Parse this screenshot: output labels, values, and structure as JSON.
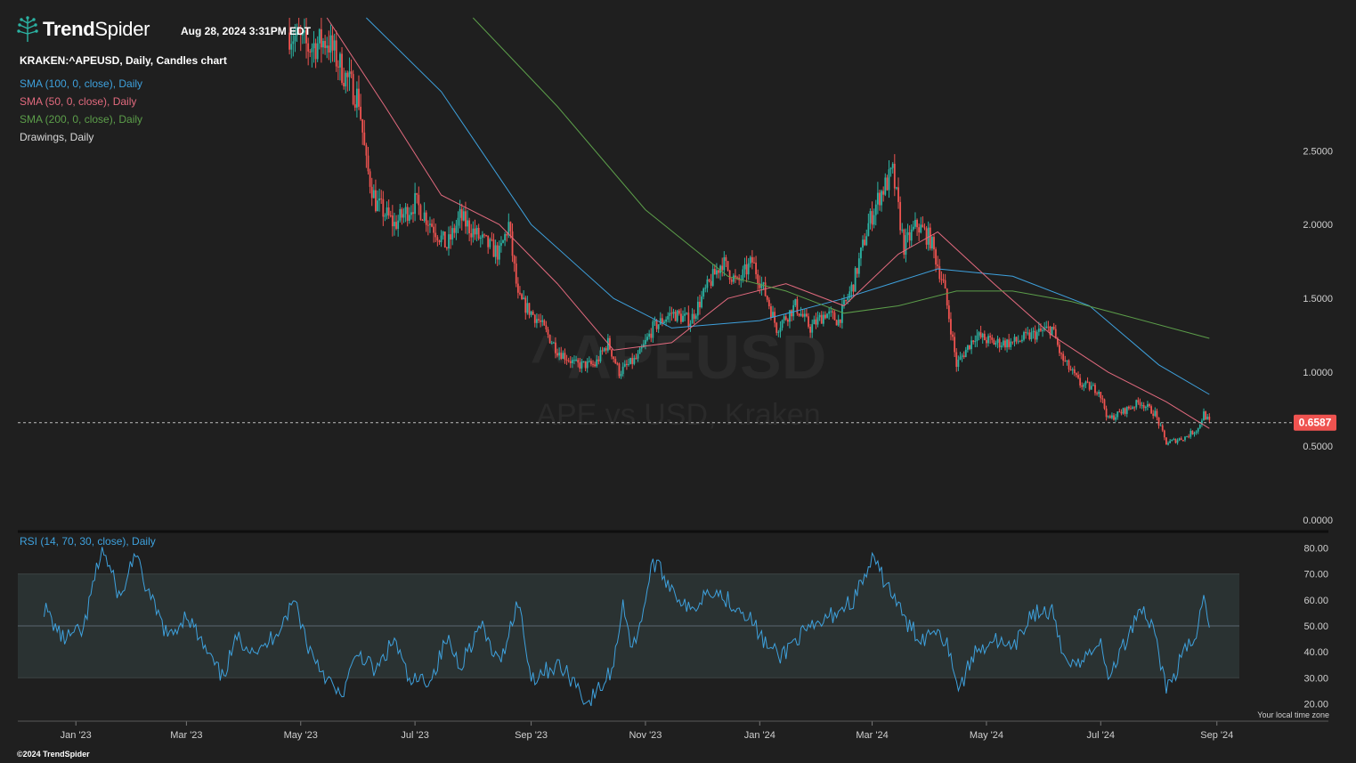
{
  "brand": {
    "name_bold": "Trend",
    "name_light": "Spider",
    "logo_icon": "tree-icon"
  },
  "timestamp": "Aug 28, 2024 3:31PM EDT",
  "chart_title": "KRAKEN:^APEUSD, Daily, Candles chart",
  "watermark": {
    "symbol": "^APEUSD",
    "description": "APE vs USD, Kraken"
  },
  "indicators": [
    {
      "label": "SMA (100, 0, close), Daily",
      "color": "#3ea1dd"
    },
    {
      "label": "SMA (50, 0, close), Daily",
      "color": "#e26a7e"
    },
    {
      "label": "SMA (200, 0, close), Daily",
      "color": "#5c9e4a"
    },
    {
      "label": "Drawings, Daily",
      "color": "#d8d8d8"
    }
  ],
  "rsi_label": "RSI (14, 70, 30, close), Daily",
  "footer": "©2024 TrendSpider",
  "timezone_note": "Your local time zone",
  "colors": {
    "background": "#1f1f1f",
    "candle_up": "#2bb3a3",
    "candle_down": "#ef5350",
    "price_tag": "#ef5350",
    "rsi_line": "#3ea1dd",
    "rsi_band": "#2a3232"
  },
  "chart_data": [
    {
      "type": "candlestick",
      "title": "KRAKEN:^APEUSD, Daily, Candles chart",
      "ylim": [
        0,
        3.4
      ],
      "y_ticks": [
        "0.0000",
        "0.5000",
        "1.0000",
        "1.5000",
        "2.0000",
        "2.5000"
      ],
      "x_ticks": [
        "Jan '23",
        "Mar '23",
        "May '23",
        "Jul '23",
        "Sep '23",
        "Nov '23",
        "Jan '24",
        "Mar '24",
        "May '24",
        "Jul '24",
        "Sep '24"
      ],
      "last_price": 0.6587,
      "last_price_label": "0.6587",
      "grid": false,
      "close_path": [
        {
          "date": "2023-04-25",
          "value": 3.3
        },
        {
          "date": "2023-05-05",
          "value": 3.2
        },
        {
          "date": "2023-05-15",
          "value": 3.25
        },
        {
          "date": "2023-05-25",
          "value": 3.0
        },
        {
          "date": "2023-06-01",
          "value": 2.85
        },
        {
          "date": "2023-06-05",
          "value": 2.4
        },
        {
          "date": "2023-06-10",
          "value": 2.15
        },
        {
          "date": "2023-06-20",
          "value": 2.0
        },
        {
          "date": "2023-07-01",
          "value": 2.15
        },
        {
          "date": "2023-07-10",
          "value": 2.0
        },
        {
          "date": "2023-07-18",
          "value": 1.85
        },
        {
          "date": "2023-07-25",
          "value": 2.05
        },
        {
          "date": "2023-08-05",
          "value": 1.9
        },
        {
          "date": "2023-08-15",
          "value": 1.8
        },
        {
          "date": "2023-08-20",
          "value": 2.0
        },
        {
          "date": "2023-08-25",
          "value": 1.5
        },
        {
          "date": "2023-09-05",
          "value": 1.35
        },
        {
          "date": "2023-09-15",
          "value": 1.15
        },
        {
          "date": "2023-09-25",
          "value": 1.05
        },
        {
          "date": "2023-10-05",
          "value": 1.05
        },
        {
          "date": "2023-10-12",
          "value": 1.2
        },
        {
          "date": "2023-10-18",
          "value": 1.0
        },
        {
          "date": "2023-10-28",
          "value": 1.1
        },
        {
          "date": "2023-11-05",
          "value": 1.3
        },
        {
          "date": "2023-11-15",
          "value": 1.4
        },
        {
          "date": "2023-11-25",
          "value": 1.35
        },
        {
          "date": "2023-12-05",
          "value": 1.6
        },
        {
          "date": "2023-12-12",
          "value": 1.75
        },
        {
          "date": "2023-12-20",
          "value": 1.6
        },
        {
          "date": "2023-12-28",
          "value": 1.75
        },
        {
          "date": "2024-01-05",
          "value": 1.5
        },
        {
          "date": "2024-01-10",
          "value": 1.3
        },
        {
          "date": "2024-01-20",
          "value": 1.45
        },
        {
          "date": "2024-01-28",
          "value": 1.3
        },
        {
          "date": "2024-02-05",
          "value": 1.4
        },
        {
          "date": "2024-02-12",
          "value": 1.35
        },
        {
          "date": "2024-02-20",
          "value": 1.6
        },
        {
          "date": "2024-02-28",
          "value": 2.0
        },
        {
          "date": "2024-03-05",
          "value": 2.2
        },
        {
          "date": "2024-03-12",
          "value": 2.35
        },
        {
          "date": "2024-03-18",
          "value": 1.85
        },
        {
          "date": "2024-03-25",
          "value": 2.0
        },
        {
          "date": "2024-04-01",
          "value": 1.9
        },
        {
          "date": "2024-04-08",
          "value": 1.6
        },
        {
          "date": "2024-04-12",
          "value": 1.3
        },
        {
          "date": "2024-04-15",
          "value": 1.05
        },
        {
          "date": "2024-04-25",
          "value": 1.25
        },
        {
          "date": "2024-05-05",
          "value": 1.2
        },
        {
          "date": "2024-05-15",
          "value": 1.2
        },
        {
          "date": "2024-05-25",
          "value": 1.25
        },
        {
          "date": "2024-06-05",
          "value": 1.3
        },
        {
          "date": "2024-06-10",
          "value": 1.1
        },
        {
          "date": "2024-06-20",
          "value": 0.92
        },
        {
          "date": "2024-06-30",
          "value": 0.88
        },
        {
          "date": "2024-07-05",
          "value": 0.68
        },
        {
          "date": "2024-07-15",
          "value": 0.75
        },
        {
          "date": "2024-07-22",
          "value": 0.8
        },
        {
          "date": "2024-07-30",
          "value": 0.72
        },
        {
          "date": "2024-08-05",
          "value": 0.52
        },
        {
          "date": "2024-08-15",
          "value": 0.56
        },
        {
          "date": "2024-08-22",
          "value": 0.62
        },
        {
          "date": "2024-08-25",
          "value": 0.72
        },
        {
          "date": "2024-08-28",
          "value": 0.66
        }
      ],
      "series": [
        {
          "name": "SMA (100, 0, close), Daily",
          "color": "#3ea1dd",
          "points": [
            {
              "date": "2023-06-05",
              "value": 3.4
            },
            {
              "date": "2023-07-15",
              "value": 2.9
            },
            {
              "date": "2023-09-01",
              "value": 2.0
            },
            {
              "date": "2023-10-15",
              "value": 1.5
            },
            {
              "date": "2023-11-15",
              "value": 1.3
            },
            {
              "date": "2024-01-01",
              "value": 1.35
            },
            {
              "date": "2024-02-15",
              "value": 1.5
            },
            {
              "date": "2024-04-05",
              "value": 1.7
            },
            {
              "date": "2024-05-15",
              "value": 1.65
            },
            {
              "date": "2024-06-25",
              "value": 1.45
            },
            {
              "date": "2024-08-01",
              "value": 1.05
            },
            {
              "date": "2024-08-28",
              "value": 0.85
            }
          ]
        },
        {
          "name": "SMA (50, 0, close), Daily",
          "color": "#e26a7e",
          "points": [
            {
              "date": "2023-05-15",
              "value": 3.4
            },
            {
              "date": "2023-06-15",
              "value": 2.8
            },
            {
              "date": "2023-07-15",
              "value": 2.2
            },
            {
              "date": "2023-08-15",
              "value": 2.0
            },
            {
              "date": "2023-09-15",
              "value": 1.6
            },
            {
              "date": "2023-10-15",
              "value": 1.15
            },
            {
              "date": "2023-11-15",
              "value": 1.2
            },
            {
              "date": "2023-12-15",
              "value": 1.5
            },
            {
              "date": "2024-01-15",
              "value": 1.6
            },
            {
              "date": "2024-02-15",
              "value": 1.45
            },
            {
              "date": "2024-03-15",
              "value": 1.8
            },
            {
              "date": "2024-04-05",
              "value": 1.95
            },
            {
              "date": "2024-05-05",
              "value": 1.6
            },
            {
              "date": "2024-06-05",
              "value": 1.25
            },
            {
              "date": "2024-07-05",
              "value": 1.0
            },
            {
              "date": "2024-08-05",
              "value": 0.8
            },
            {
              "date": "2024-08-28",
              "value": 0.62
            }
          ]
        },
        {
          "name": "SMA (200, 0, close), Daily",
          "color": "#5c9e4a",
          "points": [
            {
              "date": "2023-08-01",
              "value": 3.4
            },
            {
              "date": "2023-09-15",
              "value": 2.8
            },
            {
              "date": "2023-11-01",
              "value": 2.1
            },
            {
              "date": "2023-12-15",
              "value": 1.65
            },
            {
              "date": "2024-01-15",
              "value": 1.55
            },
            {
              "date": "2024-02-15",
              "value": 1.4
            },
            {
              "date": "2024-03-15",
              "value": 1.45
            },
            {
              "date": "2024-04-15",
              "value": 1.55
            },
            {
              "date": "2024-05-15",
              "value": 1.55
            },
            {
              "date": "2024-06-15",
              "value": 1.48
            },
            {
              "date": "2024-07-15",
              "value": 1.38
            },
            {
              "date": "2024-08-28",
              "value": 1.23
            }
          ]
        }
      ]
    },
    {
      "type": "line",
      "title": "RSI (14, 70, 30, close), Daily",
      "ylim": [
        15,
        85
      ],
      "y_ticks": [
        "20.00",
        "30.00",
        "40.00",
        "50.00",
        "60.00",
        "70.00",
        "80.00"
      ],
      "bands": [
        30,
        70
      ],
      "midline": 50,
      "series": [
        {
          "name": "RSI (14, 70, 30, close), Daily",
          "color": "#3ea1dd",
          "points": [
            {
              "date": "2022-12-15",
              "value": 57
            },
            {
              "date": "2022-12-25",
              "value": 45
            },
            {
              "date": "2023-01-05",
              "value": 48
            },
            {
              "date": "2023-01-10",
              "value": 65
            },
            {
              "date": "2023-01-15",
              "value": 80
            },
            {
              "date": "2023-01-25",
              "value": 60
            },
            {
              "date": "2023-02-01",
              "value": 78
            },
            {
              "date": "2023-02-10",
              "value": 60
            },
            {
              "date": "2023-02-20",
              "value": 45
            },
            {
              "date": "2023-03-01",
              "value": 55
            },
            {
              "date": "2023-03-10",
              "value": 42
            },
            {
              "date": "2023-03-20",
              "value": 30
            },
            {
              "date": "2023-03-28",
              "value": 45
            },
            {
              "date": "2023-04-10",
              "value": 40
            },
            {
              "date": "2023-04-20",
              "value": 50
            },
            {
              "date": "2023-04-28",
              "value": 60
            },
            {
              "date": "2023-05-05",
              "value": 42
            },
            {
              "date": "2023-05-15",
              "value": 30
            },
            {
              "date": "2023-05-22",
              "value": 22
            },
            {
              "date": "2023-06-01",
              "value": 40
            },
            {
              "date": "2023-06-10",
              "value": 32
            },
            {
              "date": "2023-06-20",
              "value": 45
            },
            {
              "date": "2023-06-28",
              "value": 28
            },
            {
              "date": "2023-07-10",
              "value": 30
            },
            {
              "date": "2023-07-18",
              "value": 45
            },
            {
              "date": "2023-07-25",
              "value": 35
            },
            {
              "date": "2023-08-05",
              "value": 50
            },
            {
              "date": "2023-08-15",
              "value": 35
            },
            {
              "date": "2023-08-25",
              "value": 60
            },
            {
              "date": "2023-09-01",
              "value": 30
            },
            {
              "date": "2023-09-15",
              "value": 35
            },
            {
              "date": "2023-09-25",
              "value": 28
            },
            {
              "date": "2023-10-01",
              "value": 20
            },
            {
              "date": "2023-10-10",
              "value": 28
            },
            {
              "date": "2023-10-15",
              "value": 35
            },
            {
              "date": "2023-10-20",
              "value": 60
            },
            {
              "date": "2023-10-25",
              "value": 40
            },
            {
              "date": "2023-11-01",
              "value": 60
            },
            {
              "date": "2023-11-05",
              "value": 75
            },
            {
              "date": "2023-11-15",
              "value": 65
            },
            {
              "date": "2023-11-25",
              "value": 55
            },
            {
              "date": "2023-12-05",
              "value": 65
            },
            {
              "date": "2023-12-15",
              "value": 60
            },
            {
              "date": "2023-12-25",
              "value": 55
            },
            {
              "date": "2024-01-05",
              "value": 42
            },
            {
              "date": "2024-01-12",
              "value": 38
            },
            {
              "date": "2024-01-20",
              "value": 45
            },
            {
              "date": "2024-02-01",
              "value": 50
            },
            {
              "date": "2024-02-10",
              "value": 55
            },
            {
              "date": "2024-02-20",
              "value": 60
            },
            {
              "date": "2024-03-01",
              "value": 75
            },
            {
              "date": "2024-03-10",
              "value": 65
            },
            {
              "date": "2024-03-20",
              "value": 50
            },
            {
              "date": "2024-03-28",
              "value": 45
            },
            {
              "date": "2024-04-05",
              "value": 50
            },
            {
              "date": "2024-04-12",
              "value": 40
            },
            {
              "date": "2024-04-16",
              "value": 25
            },
            {
              "date": "2024-04-25",
              "value": 40
            },
            {
              "date": "2024-05-05",
              "value": 45
            },
            {
              "date": "2024-05-15",
              "value": 40
            },
            {
              "date": "2024-05-25",
              "value": 55
            },
            {
              "date": "2024-06-05",
              "value": 55
            },
            {
              "date": "2024-06-10",
              "value": 40
            },
            {
              "date": "2024-06-20",
              "value": 35
            },
            {
              "date": "2024-06-30",
              "value": 45
            },
            {
              "date": "2024-07-05",
              "value": 30
            },
            {
              "date": "2024-07-15",
              "value": 45
            },
            {
              "date": "2024-07-22",
              "value": 58
            },
            {
              "date": "2024-07-30",
              "value": 48
            },
            {
              "date": "2024-08-05",
              "value": 25
            },
            {
              "date": "2024-08-15",
              "value": 40
            },
            {
              "date": "2024-08-22",
              "value": 48
            },
            {
              "date": "2024-08-25",
              "value": 65
            },
            {
              "date": "2024-08-28",
              "value": 50
            }
          ]
        }
      ]
    }
  ]
}
